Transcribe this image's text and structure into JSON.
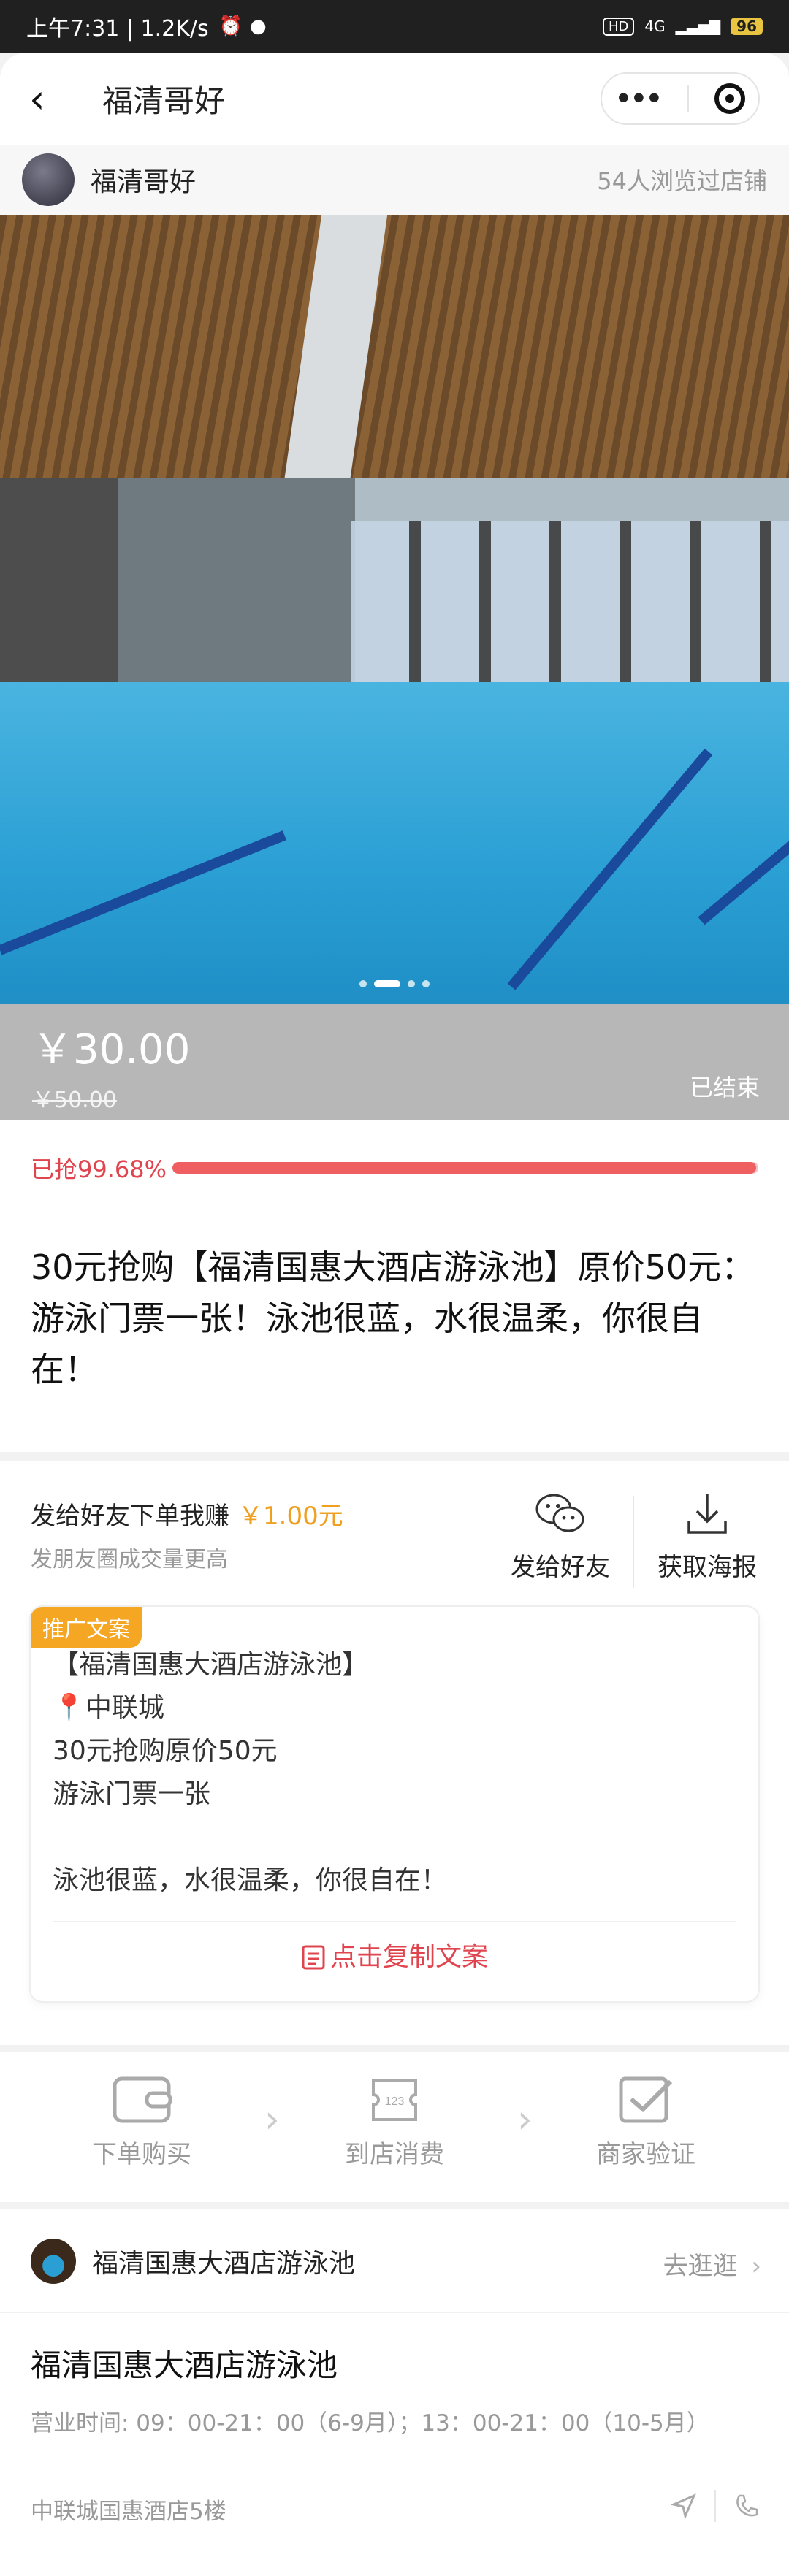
{
  "status_bar": {
    "time_speed": "上午7:31 | 1.2K/s",
    "net": "4G",
    "hd": "HD",
    "battery": "96"
  },
  "nav": {
    "title": "福清哥好",
    "more_label": "•••"
  },
  "shop": {
    "name": "福清哥好",
    "views": "54人浏览过店铺"
  },
  "hero": {
    "image_desc_icon": "pool-photo",
    "slide_count": 3,
    "active_slide": 1
  },
  "price": {
    "current": "￥30.00",
    "original": "￥50.00",
    "status": "已结束"
  },
  "progress": {
    "label": "已抢99.68%",
    "percent": 99.68
  },
  "product": {
    "title": "30元抢购【福清国惠大酒店游泳池】原价50元：游泳门票一张！泳池很蓝，水很温柔，你很自在！"
  },
  "share": {
    "earn_label": "发给好友下单我赚",
    "earn_amount": "￥1.00元",
    "earn_sub": "发朋友圈成交量更高",
    "send_friend": "发给好友",
    "get_poster": "获取海报"
  },
  "promo": {
    "tag": "推广文案",
    "text": "【福清国惠大酒店游泳池】\n📍中联城\n30元抢购原价50元\n游泳门票一张\n\n泳池很蓝，水很温柔，你很自在！",
    "copy_label": "点击复制文案"
  },
  "flow": {
    "step1": "下单购买",
    "step2": "到店消费",
    "step3": "商家验证"
  },
  "store": {
    "header_name": "福清国惠大酒店游泳池",
    "visit": "去逛逛",
    "name": "福清国惠大酒店游泳池",
    "hours": "营业时间: 09：00-21：00（6-9月）；13：00-21：00（10-5月）",
    "address": "中联城国惠酒店5楼"
  },
  "colors": {
    "accent_red": "#e0454f",
    "accent_orange": "#f5a623",
    "price_bg": "#b7b7b7"
  }
}
